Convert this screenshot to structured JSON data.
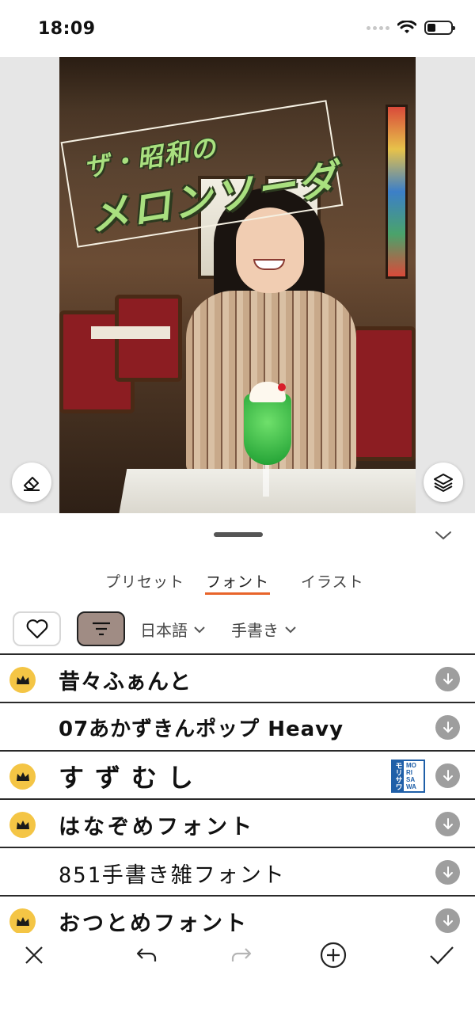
{
  "status_bar": {
    "time": "18:09"
  },
  "canvas": {
    "sticker_line1": "ザ・昭和の",
    "sticker_line2": "メロンソーダ"
  },
  "tabs": {
    "preset": "プリセット",
    "font": "フォント",
    "illust": "イラスト",
    "active": "フォント"
  },
  "filters": {
    "language": "日本語",
    "style": "手書き"
  },
  "fonts": [
    {
      "name": "昔々ふぁんと",
      "premium": true
    },
    {
      "name": "07あかずきんポップ Heavy",
      "premium": false
    },
    {
      "name": "すずむし",
      "premium": true,
      "badge": "MORISAWA"
    },
    {
      "name": "はなぞめフォント",
      "premium": true
    },
    {
      "name": "851手書き雑フォント",
      "premium": false
    },
    {
      "name": "おつとめフォント",
      "premium": true
    }
  ],
  "badge": {
    "morisawa_logo": "モリサワ",
    "morisawa_text_1": "MO",
    "morisawa_text_2": "RI",
    "morisawa_text_3": "SA",
    "morisawa_text_4": "WA"
  },
  "icons": {
    "crown": "crown-icon",
    "download": "download-icon",
    "heart": "heart-icon",
    "sort": "sort-icon",
    "eraser": "eraser-icon",
    "layers": "layers-icon"
  },
  "colors": {
    "accent": "#e8642a",
    "crown": "#f4c545",
    "sort_button": "#a08c84",
    "download": "#9e9e9e"
  }
}
